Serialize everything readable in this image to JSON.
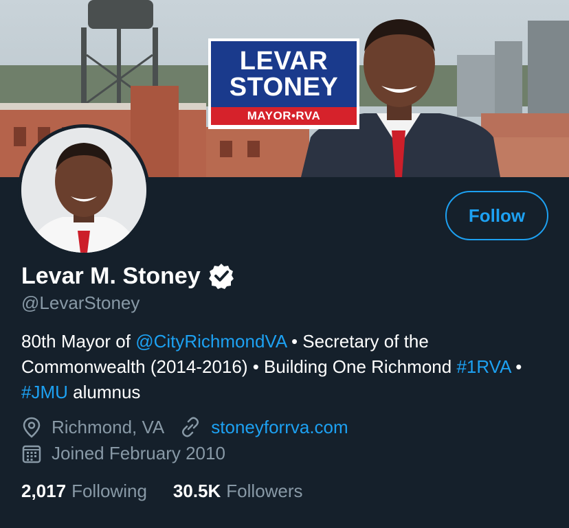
{
  "banner": {
    "sign_line1": "LEVAR",
    "sign_line2": "STONEY",
    "sign_tagline": "MAYOR•RVA"
  },
  "profile": {
    "name": "Levar M. Stoney",
    "handle": "@LevarStoney",
    "verified": true,
    "follow_label": "Follow",
    "bio": {
      "part1": "80th Mayor of ",
      "mention": "@CityRichmondVA",
      "part2": " • Secretary of the Commonwealth (2014-2016) • Building One Richmond ",
      "tag1": "#1RVA",
      "sep": " • ",
      "tag2": "#JMU",
      "part3": " alumnus"
    },
    "location": "Richmond, VA",
    "website": "stoneyforrva.com",
    "joined": "Joined February 2010",
    "stats": {
      "following_count": "2,017",
      "following_label": "Following",
      "followers_count": "30.5K",
      "followers_label": "Followers"
    }
  },
  "colors": {
    "background": "#15202b",
    "accent": "#1da1f2",
    "secondary_text": "#8899a6"
  },
  "icons": [
    "verified-badge-icon",
    "location-pin-icon",
    "link-icon",
    "calendar-icon"
  ]
}
